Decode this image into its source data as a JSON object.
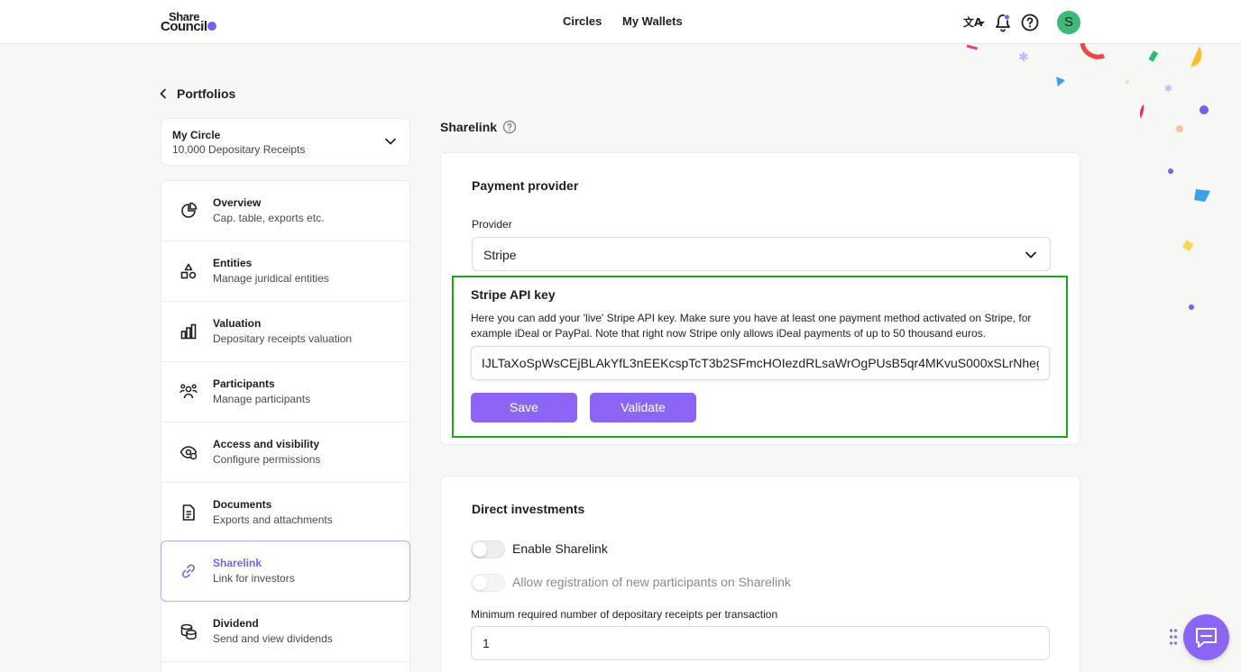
{
  "header": {
    "logo_line1": "Share",
    "logo_line2": "Council",
    "nav": [
      "Circles",
      "My Wallets"
    ],
    "avatar_initial": "S",
    "accent": "#7b5cf5"
  },
  "breadcrumb": {
    "label": "Portfolios"
  },
  "circle": {
    "name": "My Circle",
    "subtitle": "10,000 Depositary Receipts"
  },
  "menu": [
    {
      "title": "Overview",
      "sub": "Cap. table, exports etc.",
      "icon": "pie-chart-icon"
    },
    {
      "title": "Entities",
      "sub": "Manage juridical entities",
      "icon": "shapes-icon"
    },
    {
      "title": "Valuation",
      "sub": "Depositary receipts valuation",
      "icon": "bar-chart-icon"
    },
    {
      "title": "Participants",
      "sub": "Manage participants",
      "icon": "users-icon"
    },
    {
      "title": "Access and visibility",
      "sub": "Configure permissions",
      "icon": "eye-icon"
    },
    {
      "title": "Documents",
      "sub": "Exports and attachments",
      "icon": "document-icon"
    },
    {
      "title": "Sharelink",
      "sub": "Link for investors",
      "icon": "link-icon",
      "active": true
    },
    {
      "title": "Dividend",
      "sub": "Send and view dividends",
      "icon": "coins-icon"
    }
  ],
  "main": {
    "section_title": "Sharelink",
    "payment": {
      "heading": "Payment provider",
      "provider_label": "Provider",
      "provider_value": "Stripe",
      "api_title": "Stripe API key",
      "api_desc": "Here you can add your 'live' Stripe API key. Make sure you have at least one payment method activated on Stripe, for example iDeal or PayPal. Note that right now Stripe only allows iDeal payments of up to 50 thousand euros.",
      "api_value": "IJLTaXoSpWsCEjBLAkYfL3nEEKcspTcT3b2SFmcHOIezdRLsaWrOgPUsB5qr4MKvuS000xSLrNheg",
      "save_label": "Save",
      "validate_label": "Validate"
    },
    "direct": {
      "heading": "Direct investments",
      "toggle1_label": "Enable Sharelink",
      "toggle2_label": "Allow registration of new participants on Sharelink",
      "min_label": "Minimum required number of depositary receipts per transaction",
      "min_value": "1"
    }
  }
}
